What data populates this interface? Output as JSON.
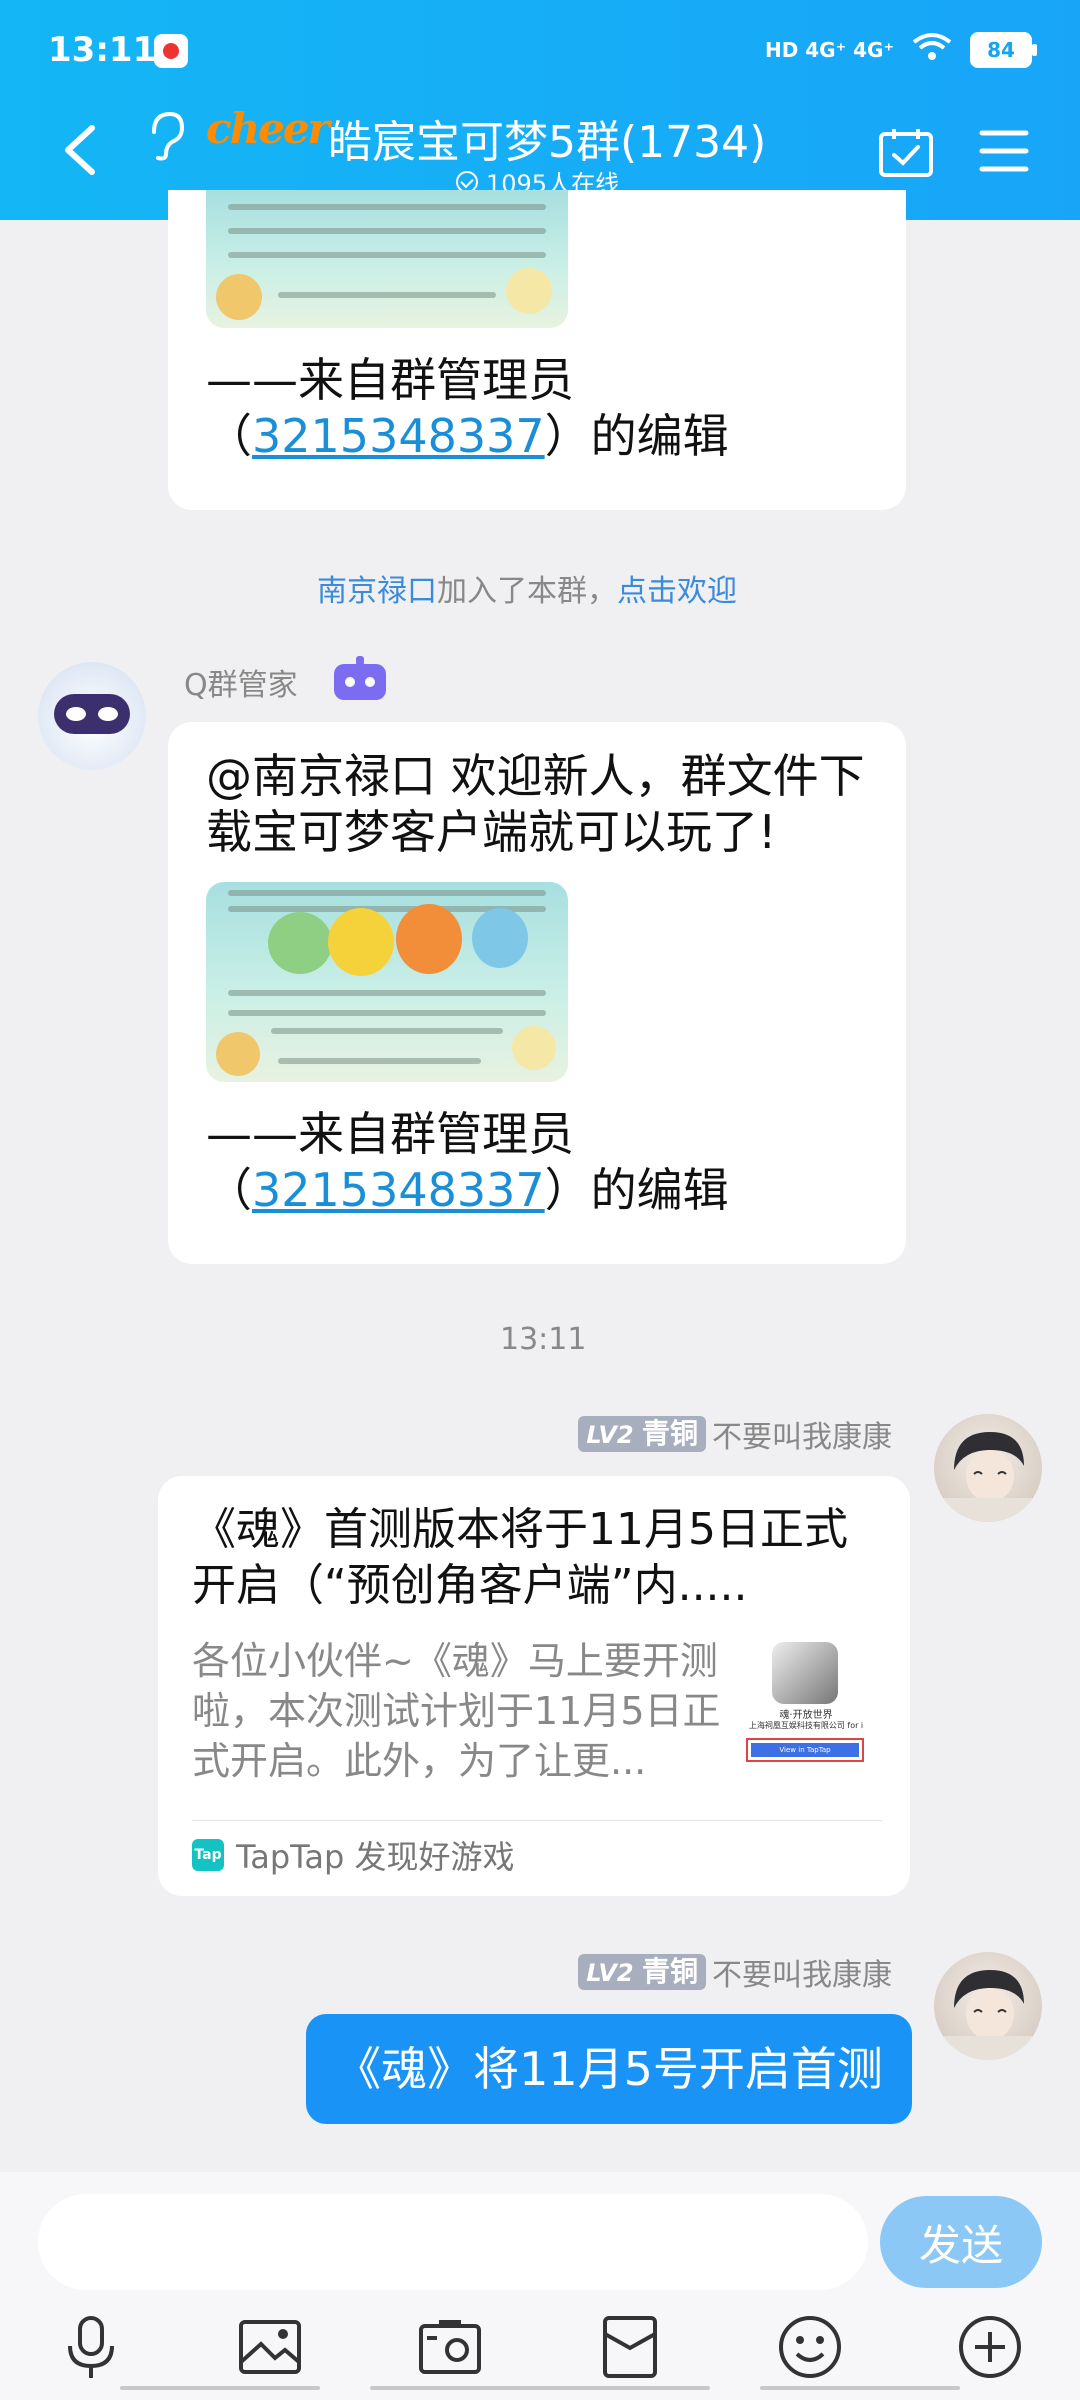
{
  "status_bar": {
    "time": "13:11",
    "network": "HD 4G⁺ 4G⁺",
    "battery": "84"
  },
  "header": {
    "logo_text": "cheer",
    "title": "皓宸宝可梦5群(1734)",
    "online": "1095人在线"
  },
  "messages": {
    "first_footer_line1": "——来自群管理员",
    "first_footer_open": "（",
    "first_footer_qq": "3215348337",
    "first_footer_close": "）的编辑",
    "join_user": "南京禄口",
    "join_text": "加入了本群，",
    "join_welcome": "点击欢迎",
    "bot_name": "Q群管家",
    "bot_text": "@南京禄口 欢迎新人，群文件下载宝可梦客户端就可以玩了!",
    "bot_footer_line1": "——来自群管理员",
    "bot_footer_open": "（",
    "bot_footer_qq": "3215348337",
    "bot_footer_close": "）的编辑",
    "time_divider": "13:11",
    "user_level": "LV2",
    "user_rank": "青铜",
    "user_name": "不要叫我康康",
    "card_title": "《魂》首测版本将于11月5日正式开启（“预创角客户端”内.....",
    "card_desc": "各位小伙伴~《魂》马上要开测啦，本次测试计划于11月5日正式开启。此外，为了让更...",
    "card_thumb_line1": "魂·开放世界",
    "card_thumb_line2": "上海祠凰互娱科技有限公司 for i",
    "card_thumb_btn": "View in TapTap",
    "card_source_icon": "Tap",
    "card_source": "TapTap 发现好游戏",
    "user_level2": "LV2",
    "user_rank2": "青铜",
    "user_name2": "不要叫我康康",
    "my_text": "《魂》将11月5号开启首测"
  },
  "input": {
    "placeholder": "",
    "send_label": "发送"
  },
  "icons": {
    "back": "chevron-left-icon",
    "ear": "ear-icon",
    "calendar": "calendar-check-icon",
    "menu": "menu-icon",
    "mic": "microphone-icon",
    "image": "image-icon",
    "camera": "camera-icon",
    "redpacket": "red-packet-icon",
    "emoji": "emoji-icon",
    "plus": "plus-icon"
  },
  "colors": {
    "header": "#18a5f8",
    "link": "#1a8fd7",
    "my_bubble": "#1a93f7",
    "send_button": "#8cc8f5"
  }
}
